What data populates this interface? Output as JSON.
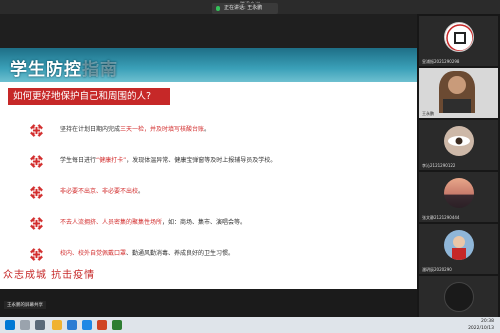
{
  "meeting": {
    "title": "腾讯会议",
    "speaker": "正在讲话: 王永鹏"
  },
  "slide": {
    "header_title_main": "学生防控",
    "header_title_faded": "指南",
    "subtitle": "如何更好地保护自己和周围的人?",
    "items": [
      {
        "prefix": "坚持在计划日期内完成",
        "highlight": "三天一检，并及时填写核酸台账",
        "suffix": "。"
      },
      {
        "prefix": "学生每日进行",
        "highlight": "“健康打卡”",
        "suffix": "，发现体温异常、健康宝弹窗等及时上报辅导员及学校。"
      },
      {
        "prefix": "",
        "highlight": "非必要不出京、非必要不出校",
        "suffix": "。"
      },
      {
        "prefix": "",
        "highlight": "不去人流拥挤、人员密集的聚集性场所",
        "suffix": "，如：商场、集市、演唱会等。"
      },
      {
        "prefix": "",
        "highlight": "校内、校外自觉佩戴口罩",
        "suffix": "、勤通风勤消毒、养成良好的卫生习惯。"
      }
    ],
    "slogan": "众志成城  抗击疫情",
    "accent_color": "#c62828"
  },
  "presenter": {
    "label": "王永鹏的屏幕共享"
  },
  "gallery": [
    {
      "name": "皇浦振2021290298",
      "avatar_icon": "stamp-avatar"
    },
    {
      "name": "王永鹏",
      "avatar_icon": "person-video"
    },
    {
      "name": "李沁2121290122",
      "avatar_icon": "eye-avatar"
    },
    {
      "name": "张文静2121290444",
      "avatar_icon": "landscape-avatar"
    },
    {
      "name": "潘玥辰2020290",
      "avatar_icon": "child-avatar"
    },
    {
      "name": "刘晓晗2121290006",
      "avatar_icon": "dark-avatar"
    }
  ],
  "clock": {
    "time": "20:38",
    "date": "2022/10/13"
  }
}
